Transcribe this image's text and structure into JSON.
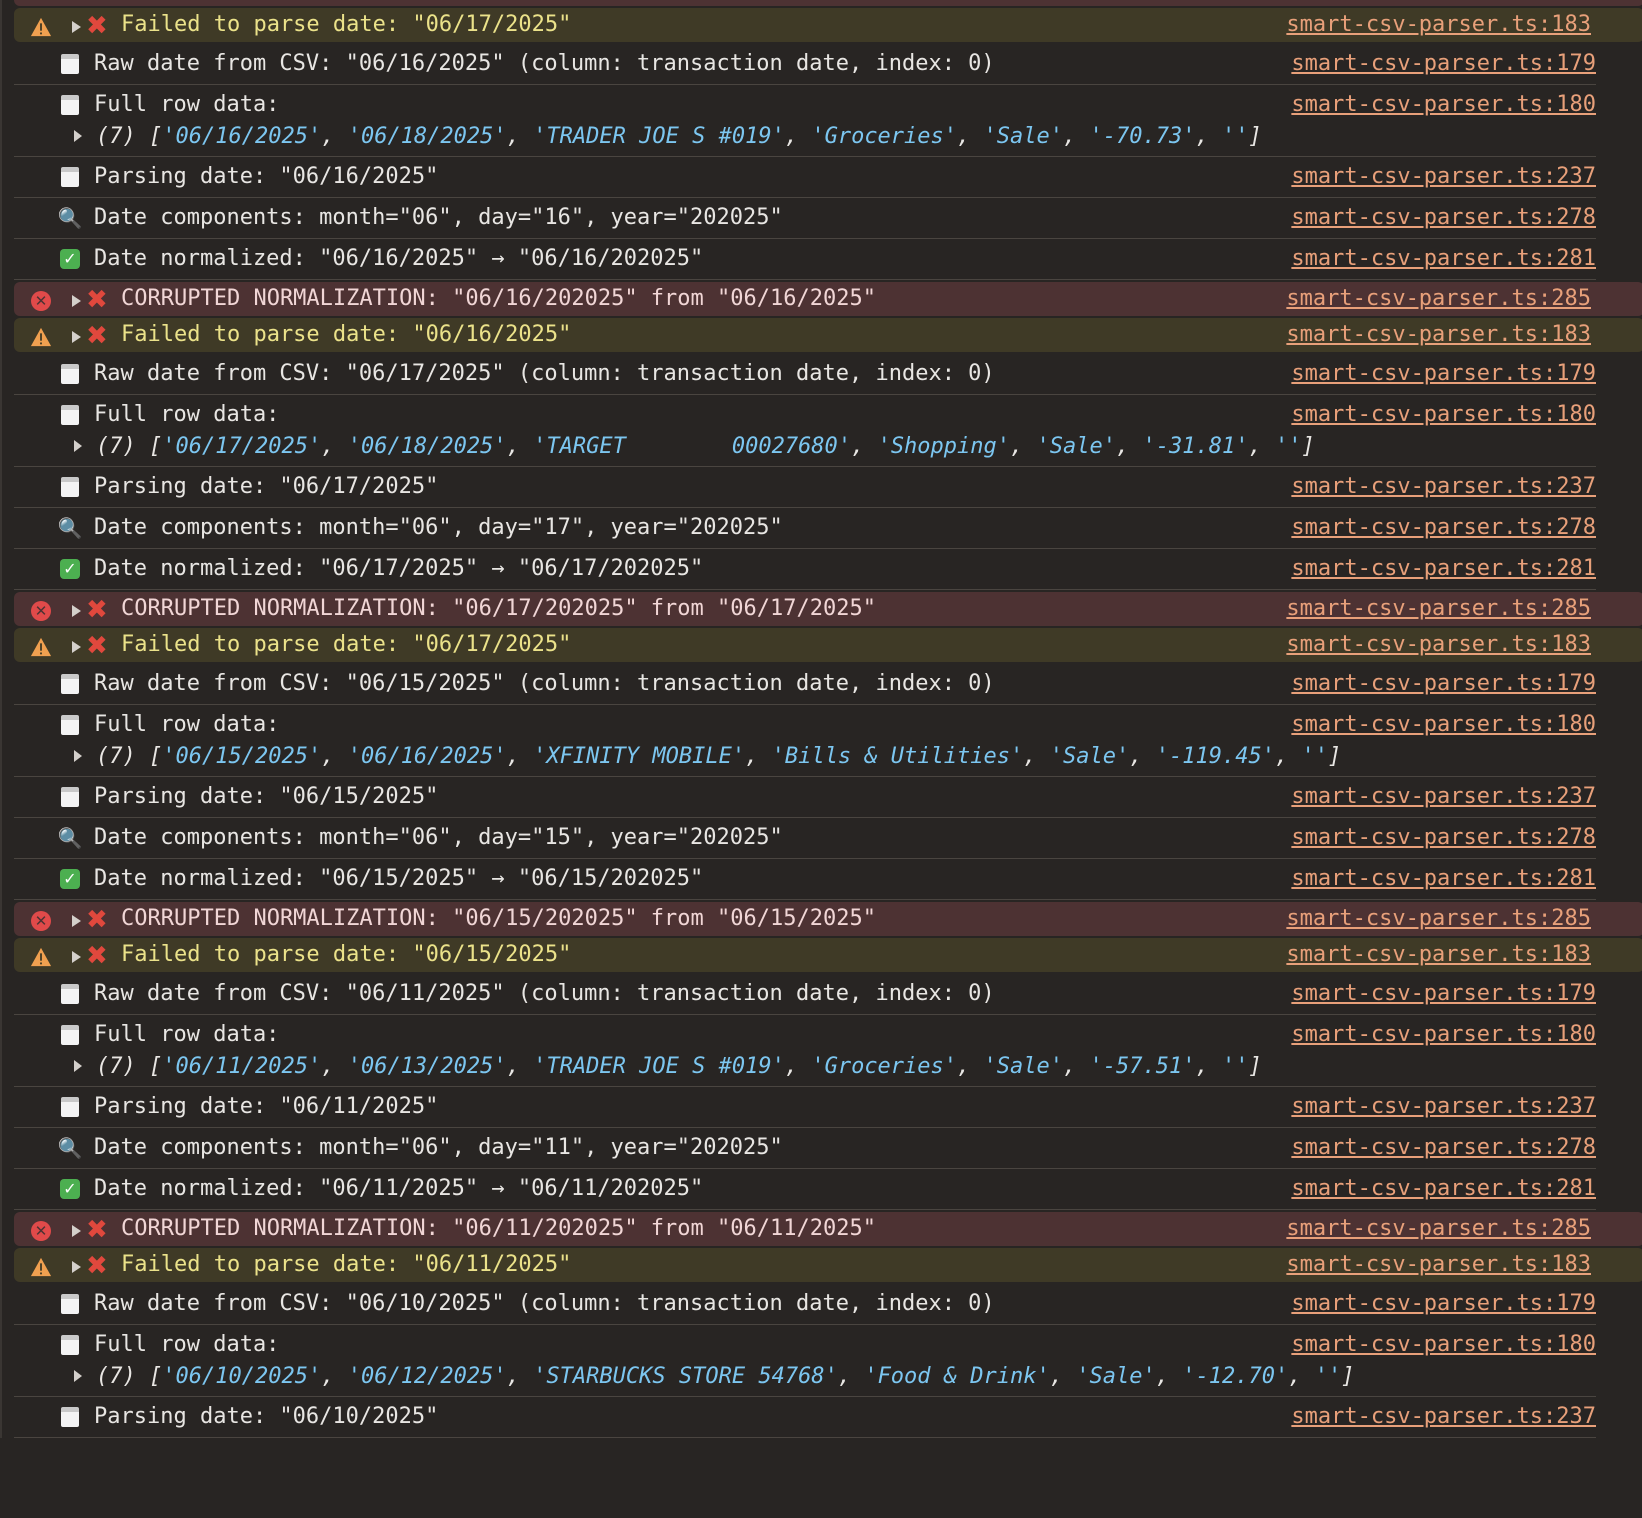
{
  "entries": [
    {
      "kind": "warn",
      "icon": "warning-icon",
      "text": "Failed to parse date: \"06/17/2025\"",
      "src": "smart-csv-parser.ts:183"
    },
    {
      "kind": "log",
      "icon": "calendar-icon",
      "text": "Raw date from CSV: \"06/16/2025\" (column: transaction date, index: 0)",
      "src": "smart-csv-parser.ts:179"
    },
    {
      "kind": "log",
      "icon": "calendar-icon",
      "text": "Full row data:",
      "src": "smart-csv-parser.ts:180",
      "array": {
        "count": "(7)",
        "items": [
          "06/16/2025",
          "06/18/2025",
          "TRADER JOE S #019",
          "Groceries",
          "Sale",
          "-70.73",
          ""
        ]
      }
    },
    {
      "kind": "log",
      "icon": "calendar-icon",
      "text": "Parsing date: \"06/16/2025\"",
      "src": "smart-csv-parser.ts:237"
    },
    {
      "kind": "log",
      "icon": "magnifier-icon",
      "text": "Date components: month=\"06\", day=\"16\", year=\"202025\"",
      "src": "smart-csv-parser.ts:278"
    },
    {
      "kind": "log",
      "icon": "checkmark-icon",
      "text": "Date normalized: \"06/16/2025\" → \"06/16/202025\"",
      "src": "smart-csv-parser.ts:281"
    },
    {
      "kind": "error",
      "icon": "error-icon",
      "text": "CORRUPTED NORMALIZATION: \"06/16/202025\" from \"06/16/2025\"",
      "src": "smart-csv-parser.ts:285"
    },
    {
      "kind": "warn",
      "icon": "warning-icon",
      "text": "Failed to parse date: \"06/16/2025\"",
      "src": "smart-csv-parser.ts:183"
    },
    {
      "kind": "log",
      "icon": "calendar-icon",
      "text": "Raw date from CSV: \"06/17/2025\" (column: transaction date, index: 0)",
      "src": "smart-csv-parser.ts:179"
    },
    {
      "kind": "log",
      "icon": "calendar-icon",
      "text": "Full row data:",
      "src": "smart-csv-parser.ts:180",
      "array": {
        "count": "(7)",
        "items": [
          "06/17/2025",
          "06/18/2025",
          "TARGET        00027680",
          "Shopping",
          "Sale",
          "-31.81",
          ""
        ]
      }
    },
    {
      "kind": "log",
      "icon": "calendar-icon",
      "text": "Parsing date: \"06/17/2025\"",
      "src": "smart-csv-parser.ts:237"
    },
    {
      "kind": "log",
      "icon": "magnifier-icon",
      "text": "Date components: month=\"06\", day=\"17\", year=\"202025\"",
      "src": "smart-csv-parser.ts:278"
    },
    {
      "kind": "log",
      "icon": "checkmark-icon",
      "text": "Date normalized: \"06/17/2025\" → \"06/17/202025\"",
      "src": "smart-csv-parser.ts:281"
    },
    {
      "kind": "error",
      "icon": "error-icon",
      "text": "CORRUPTED NORMALIZATION: \"06/17/202025\" from \"06/17/2025\"",
      "src": "smart-csv-parser.ts:285"
    },
    {
      "kind": "warn",
      "icon": "warning-icon",
      "text": "Failed to parse date: \"06/17/2025\"",
      "src": "smart-csv-parser.ts:183"
    },
    {
      "kind": "log",
      "icon": "calendar-icon",
      "text": "Raw date from CSV: \"06/15/2025\" (column: transaction date, index: 0)",
      "src": "smart-csv-parser.ts:179"
    },
    {
      "kind": "log",
      "icon": "calendar-icon",
      "text": "Full row data:",
      "src": "smart-csv-parser.ts:180",
      "array": {
        "count": "(7)",
        "items": [
          "06/15/2025",
          "06/16/2025",
          "XFINITY MOBILE",
          "Bills & Utilities",
          "Sale",
          "-119.45",
          ""
        ]
      }
    },
    {
      "kind": "log",
      "icon": "calendar-icon",
      "text": "Parsing date: \"06/15/2025\"",
      "src": "smart-csv-parser.ts:237"
    },
    {
      "kind": "log",
      "icon": "magnifier-icon",
      "text": "Date components: month=\"06\", day=\"15\", year=\"202025\"",
      "src": "smart-csv-parser.ts:278"
    },
    {
      "kind": "log",
      "icon": "checkmark-icon",
      "text": "Date normalized: \"06/15/2025\" → \"06/15/202025\"",
      "src": "smart-csv-parser.ts:281"
    },
    {
      "kind": "error",
      "icon": "error-icon",
      "text": "CORRUPTED NORMALIZATION: \"06/15/202025\" from \"06/15/2025\"",
      "src": "smart-csv-parser.ts:285"
    },
    {
      "kind": "warn",
      "icon": "warning-icon",
      "text": "Failed to parse date: \"06/15/2025\"",
      "src": "smart-csv-parser.ts:183"
    },
    {
      "kind": "log",
      "icon": "calendar-icon",
      "text": "Raw date from CSV: \"06/11/2025\" (column: transaction date, index: 0)",
      "src": "smart-csv-parser.ts:179"
    },
    {
      "kind": "log",
      "icon": "calendar-icon",
      "text": "Full row data:",
      "src": "smart-csv-parser.ts:180",
      "array": {
        "count": "(7)",
        "items": [
          "06/11/2025",
          "06/13/2025",
          "TRADER JOE S #019",
          "Groceries",
          "Sale",
          "-57.51",
          ""
        ]
      }
    },
    {
      "kind": "log",
      "icon": "calendar-icon",
      "text": "Parsing date: \"06/11/2025\"",
      "src": "smart-csv-parser.ts:237"
    },
    {
      "kind": "log",
      "icon": "magnifier-icon",
      "text": "Date components: month=\"06\", day=\"11\", year=\"202025\"",
      "src": "smart-csv-parser.ts:278"
    },
    {
      "kind": "log",
      "icon": "checkmark-icon",
      "text": "Date normalized: \"06/11/2025\" → \"06/11/202025\"",
      "src": "smart-csv-parser.ts:281"
    },
    {
      "kind": "error",
      "icon": "error-icon",
      "text": "CORRUPTED NORMALIZATION: \"06/11/202025\" from \"06/11/2025\"",
      "src": "smart-csv-parser.ts:285"
    },
    {
      "kind": "warn",
      "icon": "warning-icon",
      "text": "Failed to parse date: \"06/11/2025\"",
      "src": "smart-csv-parser.ts:183"
    },
    {
      "kind": "log",
      "icon": "calendar-icon",
      "text": "Raw date from CSV: \"06/10/2025\" (column: transaction date, index: 0)",
      "src": "smart-csv-parser.ts:179"
    },
    {
      "kind": "log",
      "icon": "calendar-icon",
      "text": "Full row data:",
      "src": "smart-csv-parser.ts:180",
      "array": {
        "count": "(7)",
        "items": [
          "06/10/2025",
          "06/12/2025",
          "STARBUCKS STORE 54768",
          "Food & Drink",
          "Sale",
          "-12.70",
          ""
        ]
      }
    },
    {
      "kind": "log",
      "icon": "calendar-icon",
      "text": "Parsing date: \"06/10/2025\"",
      "src": "smart-csv-parser.ts:237"
    }
  ],
  "colors": {
    "background": "#282523",
    "error_row": "#4d3233",
    "warning_row": "#3f3a26",
    "source_link": "#e8a07a",
    "string_value": "#7cc6f0",
    "x_mark": "#e0483d"
  }
}
